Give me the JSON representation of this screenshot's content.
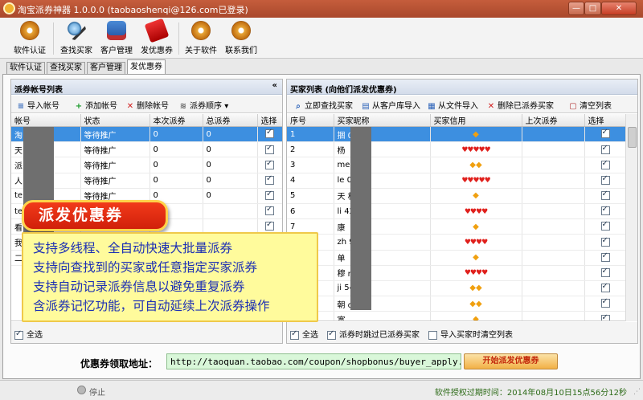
{
  "window": {
    "title": "淘宝派券神器 1.0.0.0 (taobaoshenqi@126.com已登录)",
    "min_label": "—",
    "max_label": "□",
    "close_label": "✕"
  },
  "toolbar": {
    "buttons": [
      {
        "label": "软件认证",
        "icon": "cd-icon"
      },
      {
        "label": "查找买家",
        "icon": "magnifier-user-icon"
      },
      {
        "label": "客户管理",
        "icon": "database-icon"
      },
      {
        "label": "发优惠券",
        "icon": "coupon-tag-icon"
      },
      {
        "label": "关于软件",
        "icon": "cd-icon"
      },
      {
        "label": "联系我们",
        "icon": "cd-icon"
      }
    ]
  },
  "tabs": [
    "软件认证",
    "查找买家",
    "客户管理",
    "发优惠券"
  ],
  "active_tab": "发优惠券",
  "left_panel": {
    "title": "派券帐号列表",
    "collapse_label": "«",
    "tools": [
      {
        "label": "导入帐号",
        "glyph": "≡"
      },
      {
        "label": "添加帐号",
        "glyph": "+"
      },
      {
        "label": "删除帐号",
        "glyph": "✕"
      },
      {
        "label": "派券顺序",
        "glyph": "≋"
      }
    ],
    "columns": [
      "帐号",
      "状态",
      "本次派券",
      "总派券",
      "选择"
    ],
    "rows": [
      {
        "account": "淘",
        "status": "等待推广",
        "this_time": "0",
        "total": "0",
        "checked": true
      },
      {
        "account": "天",
        "status": "等待推广",
        "this_time": "0",
        "total": "0",
        "checked": true
      },
      {
        "account": "派",
        "status": "等待推广",
        "this_time": "0",
        "total": "0",
        "checked": true
      },
      {
        "account": "人",
        "status": "等待推广",
        "this_time": "0",
        "total": "0",
        "checked": true
      },
      {
        "account": "te",
        "status": "等待推广",
        "this_time": "0",
        "total": "0",
        "checked": true
      },
      {
        "account": "te",
        "status": "",
        "this_time": "",
        "total": "",
        "checked": true
      },
      {
        "account": "看",
        "status": "",
        "this_time": "",
        "total": "",
        "checked": true
      },
      {
        "account": "我",
        "status": "",
        "this_time": "",
        "total": "",
        "checked": true
      },
      {
        "account": "二",
        "status": "",
        "this_time": "",
        "total": "",
        "checked": false
      }
    ],
    "select_all_label": "全选"
  },
  "right_panel": {
    "title": "买家列表 (向他们派发优惠券)",
    "tools": [
      {
        "label": "立即查找买家",
        "glyph": "⌕"
      },
      {
        "label": "从客户库导入",
        "glyph": "▤"
      },
      {
        "label": "从文件导入",
        "glyph": "▦"
      },
      {
        "label": "删除已派券买家",
        "glyph": "✕"
      },
      {
        "label": "清空列表",
        "glyph": "▢"
      }
    ],
    "columns": [
      "序号",
      "买家昵称",
      "买家信用",
      "上次派券",
      "选择"
    ],
    "rows": [
      {
        "no": "1",
        "nick": "捆  01",
        "credit": "◆",
        "credit_type": "gem",
        "checked": true
      },
      {
        "no": "2",
        "nick": "杨",
        "credit": "♥♥♥♥♥",
        "credit_type": "heart",
        "checked": true
      },
      {
        "no": "3",
        "nick": "me  666",
        "credit": "◆◆",
        "credit_type": "gem",
        "checked": true
      },
      {
        "no": "4",
        "nick": "le  01",
        "credit": "♥♥♥♥♥",
        "credit_type": "heart",
        "checked": true
      },
      {
        "no": "5",
        "nick": "天  相框",
        "credit": "◆",
        "credit_type": "gem",
        "checked": true
      },
      {
        "no": "6",
        "nick": "li  425",
        "credit": "♥♥♥♥",
        "credit_type": "heart",
        "checked": true
      },
      {
        "no": "7",
        "nick": "康",
        "credit": "◆",
        "credit_type": "gem",
        "checked": true
      },
      {
        "no": "8",
        "nick": "zh  911",
        "credit": "♥♥♥♥",
        "credit_type": "heart",
        "checked": true
      },
      {
        "no": "9",
        "nick": "单",
        "credit": "◆",
        "credit_type": "gem",
        "checked": true
      },
      {
        "no": "10",
        "nick": "穆  r",
        "credit": "♥♥♥♥",
        "credit_type": "heart",
        "checked": true
      },
      {
        "no": "11",
        "nick": "ji  5442",
        "credit": "◆◆",
        "credit_type": "gem",
        "checked": true
      },
      {
        "no": "12",
        "nick": "朝  ol",
        "credit": "◆◆",
        "credit_type": "gem",
        "checked": true
      },
      {
        "no": "13",
        "nick": "宽",
        "credit": "◆",
        "credit_type": "gem",
        "checked": true
      }
    ],
    "select_all_label": "全选",
    "skip_label": "派券时跳过已派券买家",
    "clear_on_import_label": "导入买家时清空列表"
  },
  "promo": {
    "badge": "派发优惠券",
    "lines": [
      "支持多线程、全自动快速大批量派券",
      "支持向查找到的买家或任意指定买家派券",
      "支持自动记录派券信息以避免重复派券",
      "含派券记忆功能，可自动延续上次派券操作"
    ]
  },
  "coupon": {
    "label": "优惠券领取地址：",
    "url": "http://taoquan.taobao.com/coupon/shopbonus/buyer_apply.htm",
    "start_button": "开始派发优惠券"
  },
  "status": {
    "state": "停止",
    "license": "软件授权过期时间：2014年08月10日15点56分12秒"
  },
  "colors": {
    "titlebar": "#b4502f",
    "selection": "#3d8fe0",
    "promo_text": "#1c2fb4",
    "url_bg": "#d9f7d9"
  }
}
